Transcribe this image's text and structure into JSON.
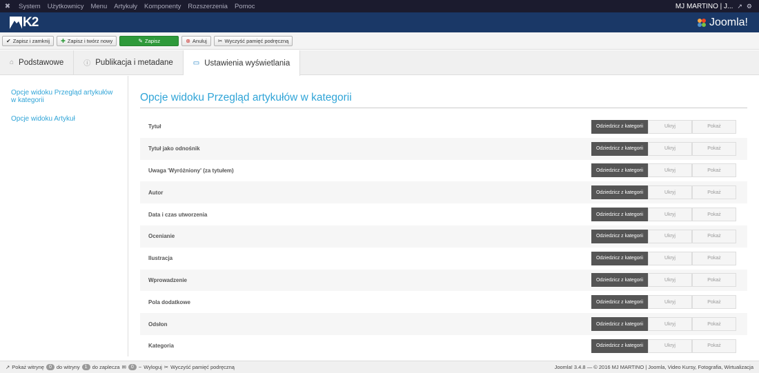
{
  "topnav": {
    "menu": [
      "System",
      "Użytkownicy",
      "Menu",
      "Artykuły",
      "Komponenty",
      "Rozszerzenia",
      "Pomoc"
    ],
    "user": "MJ MARTINO | J..."
  },
  "header": {
    "logo_text": "K2",
    "joomla_text": "Joomla!"
  },
  "toolbar": {
    "save_close": "Zapisz i zamknij",
    "save_new": "Zapisz i twórz nowy",
    "save": "Zapisz",
    "cancel": "Anuluj",
    "clear_cache": "Wyczyść pamięć podręczną"
  },
  "tabs": [
    "Podstawowe",
    "Publikacja i metadane",
    "Ustawienia wyświetlania"
  ],
  "sidebar": {
    "items": [
      "Opcje widoku Przegląd artykułów w kategorii",
      "Opcje widoku Artykuł"
    ]
  },
  "section": {
    "title": "Opcje widoku Przegląd artykułów w kategorii"
  },
  "options": {
    "choices": [
      "Odziedzicz z kategorii",
      "Ukryj",
      "Pokaż"
    ],
    "rows": [
      "Tytuł",
      "Tytuł jako odnośnik",
      "Uwaga 'Wyróżniony' (za tytułem)",
      "Autor",
      "Data i czas utworzenia",
      "Ocenianie",
      "Ilustracja",
      "Wprowadzenie",
      "Pola dodatkowe",
      "Odsłon",
      "Kategoria"
    ],
    "selected": "Odziedzicz z kategorii"
  },
  "footer": {
    "show_site": "Pokaż witrynę",
    "site_count": "0",
    "site_label": "do witryny",
    "admin_count": "1",
    "admin_label": "do zaplecza",
    "msg_count": "0",
    "logout": "Wyloguj",
    "clear_cache": "Wyczyść pamięć podręczną",
    "copyright": "Joomla! 3.4.8 — © 2016 MJ MARTINO | Joomla, Video Kursy, Fotografia, Wirtualizacja"
  },
  "colors": {
    "accent": "#2fa4d7",
    "header": "#1a3867",
    "save": "#2f9a3b"
  }
}
